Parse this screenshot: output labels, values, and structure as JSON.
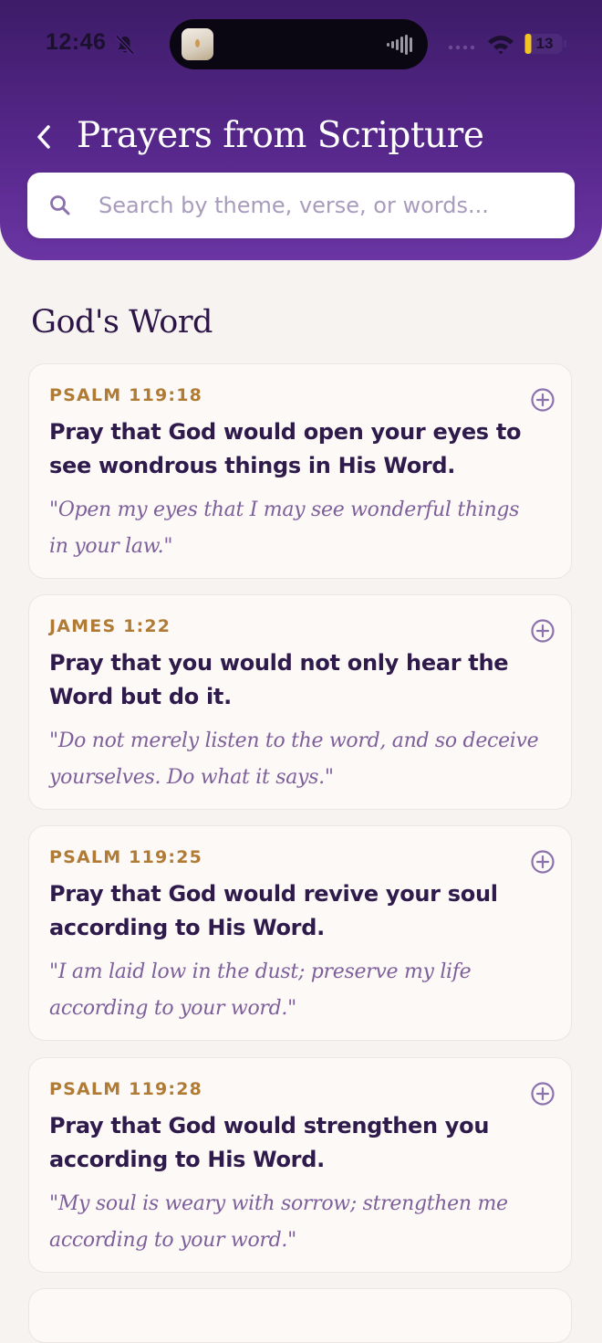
{
  "status_bar": {
    "time": "12:46",
    "battery": "13"
  },
  "header": {
    "title": "Prayers from Scripture"
  },
  "search": {
    "placeholder": "Search by theme, verse, or words..."
  },
  "section": {
    "title": "God's Word"
  },
  "cards": [
    {
      "reference": "PSALM 119:18",
      "prayer": "Pray that God would open your eyes to see wondrous things in His Word.",
      "verse": "\"Open my eyes that I may see wonderful things in your law.\""
    },
    {
      "reference": "JAMES 1:22",
      "prayer": "Pray that you would not only hear the Word but do it.",
      "verse": "\"Do not merely listen to the word, and so deceive yourselves. Do what it says.\""
    },
    {
      "reference": "PSALM 119:25",
      "prayer": "Pray that God would revive your soul according to His Word.",
      "verse": "\"I am laid low in the dust; preserve my life according to your word.\""
    },
    {
      "reference": "PSALM 119:28",
      "prayer": "Pray that God would strengthen you according to His Word.",
      "verse": "\"My soul is weary with sorrow; strengthen me according to your word.\""
    }
  ],
  "colors": {
    "header_gradient_top": "#3d1c68",
    "header_gradient_bottom": "#6a35a3",
    "reference_gold": "#b07b35",
    "prayer_text": "#2f1a4c",
    "verse_text": "#7d5f9a",
    "background": "#f6f3f1"
  },
  "icons": {
    "back": "chevron-left-icon",
    "search": "search-icon",
    "add": "plus-circle-icon",
    "silent": "bell-off-icon",
    "signal": "cell-signal-icon",
    "wifi": "wifi-icon",
    "battery": "battery-icon"
  }
}
